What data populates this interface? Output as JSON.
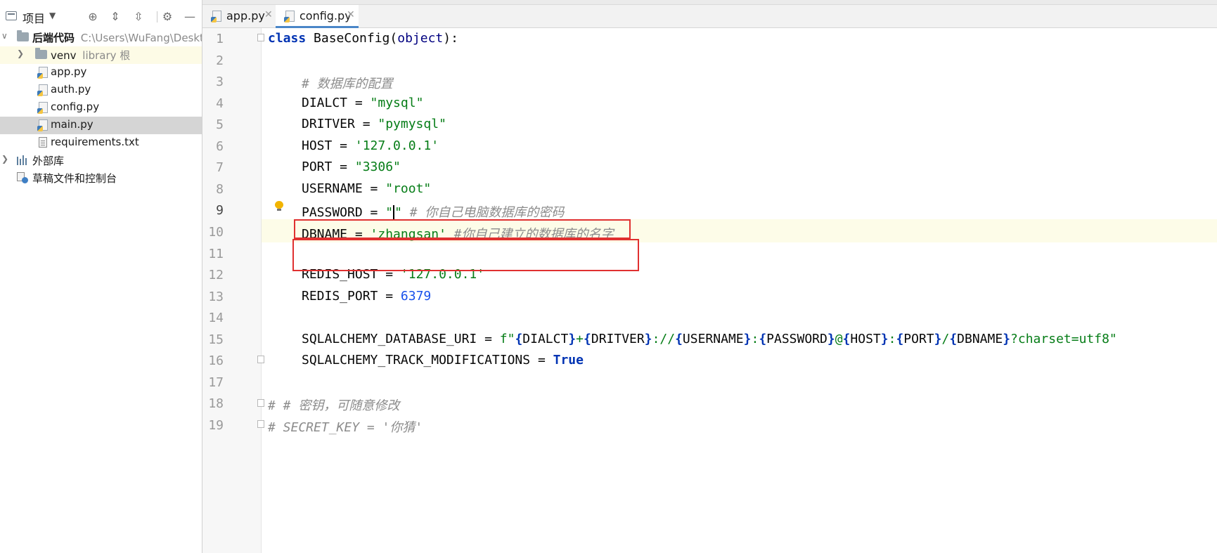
{
  "project": {
    "title": "项目",
    "root": {
      "name": "后端代码",
      "path": "C:\\Users\\WuFang\\Deskto"
    },
    "items": [
      {
        "name": "venv",
        "suffix": "library 根"
      },
      {
        "name": "app.py"
      },
      {
        "name": "auth.py"
      },
      {
        "name": "config.py"
      },
      {
        "name": "main.py"
      },
      {
        "name": "requirements.txt"
      }
    ],
    "external": "外部库",
    "scratches": "草稿文件和控制台"
  },
  "tabs": [
    {
      "label": "app.py"
    },
    {
      "label": "config.py"
    }
  ],
  "editor": {
    "line_numbers": [
      "1",
      "2",
      "3",
      "4",
      "5",
      "6",
      "7",
      "8",
      "9",
      "10",
      "11",
      "12",
      "13",
      "14",
      "15",
      "16",
      "17",
      "18",
      "19"
    ],
    "current_line": 9,
    "l1": {
      "kw": "class",
      "name": " BaseConfig(",
      "base": "object",
      "end": "):"
    },
    "l3": "# 数据库的配置",
    "l4": {
      "name": "DIALCT = ",
      "val": "\"mysql\""
    },
    "l5": {
      "name": "DRITVER = ",
      "val": "\"pymysql\""
    },
    "l6": {
      "name": "HOST = ",
      "val": "'127.0.0.1'"
    },
    "l7": {
      "name": "PORT = ",
      "val": "\"3306\""
    },
    "l8": {
      "name": "USERNAME = ",
      "val": "\"root\""
    },
    "l9": {
      "name": "PASSWORD = ",
      "q1": "\"",
      "q2": "\"",
      "cmt": " # 你自己电脑数据库的密码"
    },
    "l10": {
      "name": "DBNAME = ",
      "val": "'zhangsan'",
      "cmt": " #你自己建立的数据库的名字"
    },
    "l12": {
      "name": "REDIS_HOST = ",
      "val": "'127.0.0.1'"
    },
    "l13": {
      "name": "REDIS_PORT = ",
      "val": "6379"
    },
    "l15": {
      "name": "SQLALCHEMY_DATABASE_URI = ",
      "pre": "f\"",
      "v1": "DIALCT",
      "s1": "+",
      "v2": "DRITVER",
      "s2": "://",
      "v3": "USERNAME",
      "s3": ":",
      "v4": "PASSWORD",
      "s4": "@",
      "v5": "HOST",
      "s5": ":",
      "v6": "PORT",
      "s6": "/",
      "v7": "DBNAME",
      "s7": "?charset=utf8\""
    },
    "l16": {
      "name": "SQLALCHEMY_TRACK_MODIFICATIONS = ",
      "val": "True"
    },
    "l18": "# # 密钥，可随意修改",
    "l19": "# SECRET_KEY = '你猜'"
  },
  "colors": {
    "annotation_box": "#e03030",
    "tab_accent": "#4a86c8"
  }
}
